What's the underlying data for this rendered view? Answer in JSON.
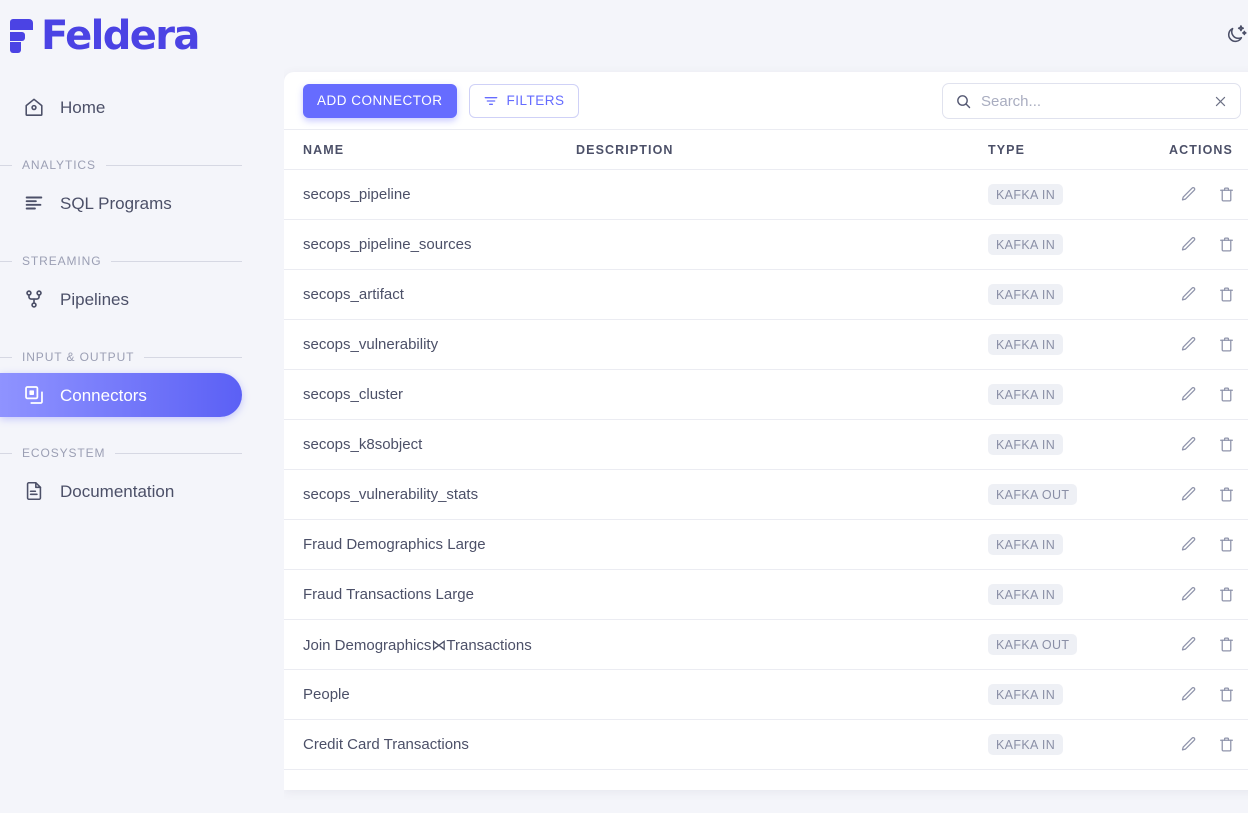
{
  "brand": {
    "name": "Feldera",
    "logo_color": "#4b43e4"
  },
  "topbar": {
    "theme_toggle_icon": "moon-stars-icon"
  },
  "sidebar": {
    "items": [
      {
        "label": "Home",
        "icon": "home-icon",
        "active": false
      },
      {
        "label": "SQL Programs",
        "icon": "sql-programs-icon",
        "active": false
      },
      {
        "label": "Pipelines",
        "icon": "pipelines-icon",
        "active": false
      },
      {
        "label": "Connectors",
        "icon": "connectors-icon",
        "active": true
      },
      {
        "label": "Documentation",
        "icon": "documentation-icon",
        "active": false
      }
    ],
    "sections": [
      {
        "label": "ANALYTICS"
      },
      {
        "label": "STREAMING"
      },
      {
        "label": "INPUT & OUTPUT"
      },
      {
        "label": "ECOSYSTEM"
      }
    ]
  },
  "toolbar": {
    "add_connector_label": "ADD CONNECTOR",
    "filters_label": "FILTERS",
    "filters_icon": "filter-icon",
    "search": {
      "value": "",
      "placeholder": "Search...",
      "search_icon": "search-icon",
      "clear_icon": "close-icon"
    }
  },
  "table": {
    "columns": [
      "NAME",
      "DESCRIPTION",
      "TYPE",
      "ACTIONS"
    ],
    "row_actions": [
      {
        "name": "edit-row-button",
        "icon": "pencil-icon"
      },
      {
        "name": "delete-row-button",
        "icon": "trash-icon"
      }
    ],
    "rows": [
      {
        "name": "secops_pipeline",
        "description": "",
        "type": "KAFKA IN"
      },
      {
        "name": "secops_pipeline_sources",
        "description": "",
        "type": "KAFKA IN"
      },
      {
        "name": "secops_artifact",
        "description": "",
        "type": "KAFKA IN"
      },
      {
        "name": "secops_vulnerability",
        "description": "",
        "type": "KAFKA IN"
      },
      {
        "name": "secops_cluster",
        "description": "",
        "type": "KAFKA IN"
      },
      {
        "name": "secops_k8sobject",
        "description": "",
        "type": "KAFKA IN"
      },
      {
        "name": "secops_vulnerability_stats",
        "description": "",
        "type": "KAFKA OUT"
      },
      {
        "name": "Fraud Demographics Large",
        "description": "",
        "type": "KAFKA IN"
      },
      {
        "name": "Fraud Transactions Large",
        "description": "",
        "type": "KAFKA IN"
      },
      {
        "name": "Join Demographics⋈Transactions",
        "description": "",
        "type": "KAFKA OUT"
      },
      {
        "name": "People",
        "description": "",
        "type": "KAFKA IN"
      },
      {
        "name": "Credit Card Transactions",
        "description": "",
        "type": "KAFKA IN"
      }
    ]
  },
  "colors": {
    "accent": "#666cff",
    "accent_gradient_start": "#8f93ff",
    "accent_gradient_end": "#5b60f5",
    "page_background": "#f4f5fa",
    "card_background": "#ffffff",
    "text": "#4c5068",
    "muted_text": "#9b9fb4",
    "badge_background": "#eef0f5"
  }
}
